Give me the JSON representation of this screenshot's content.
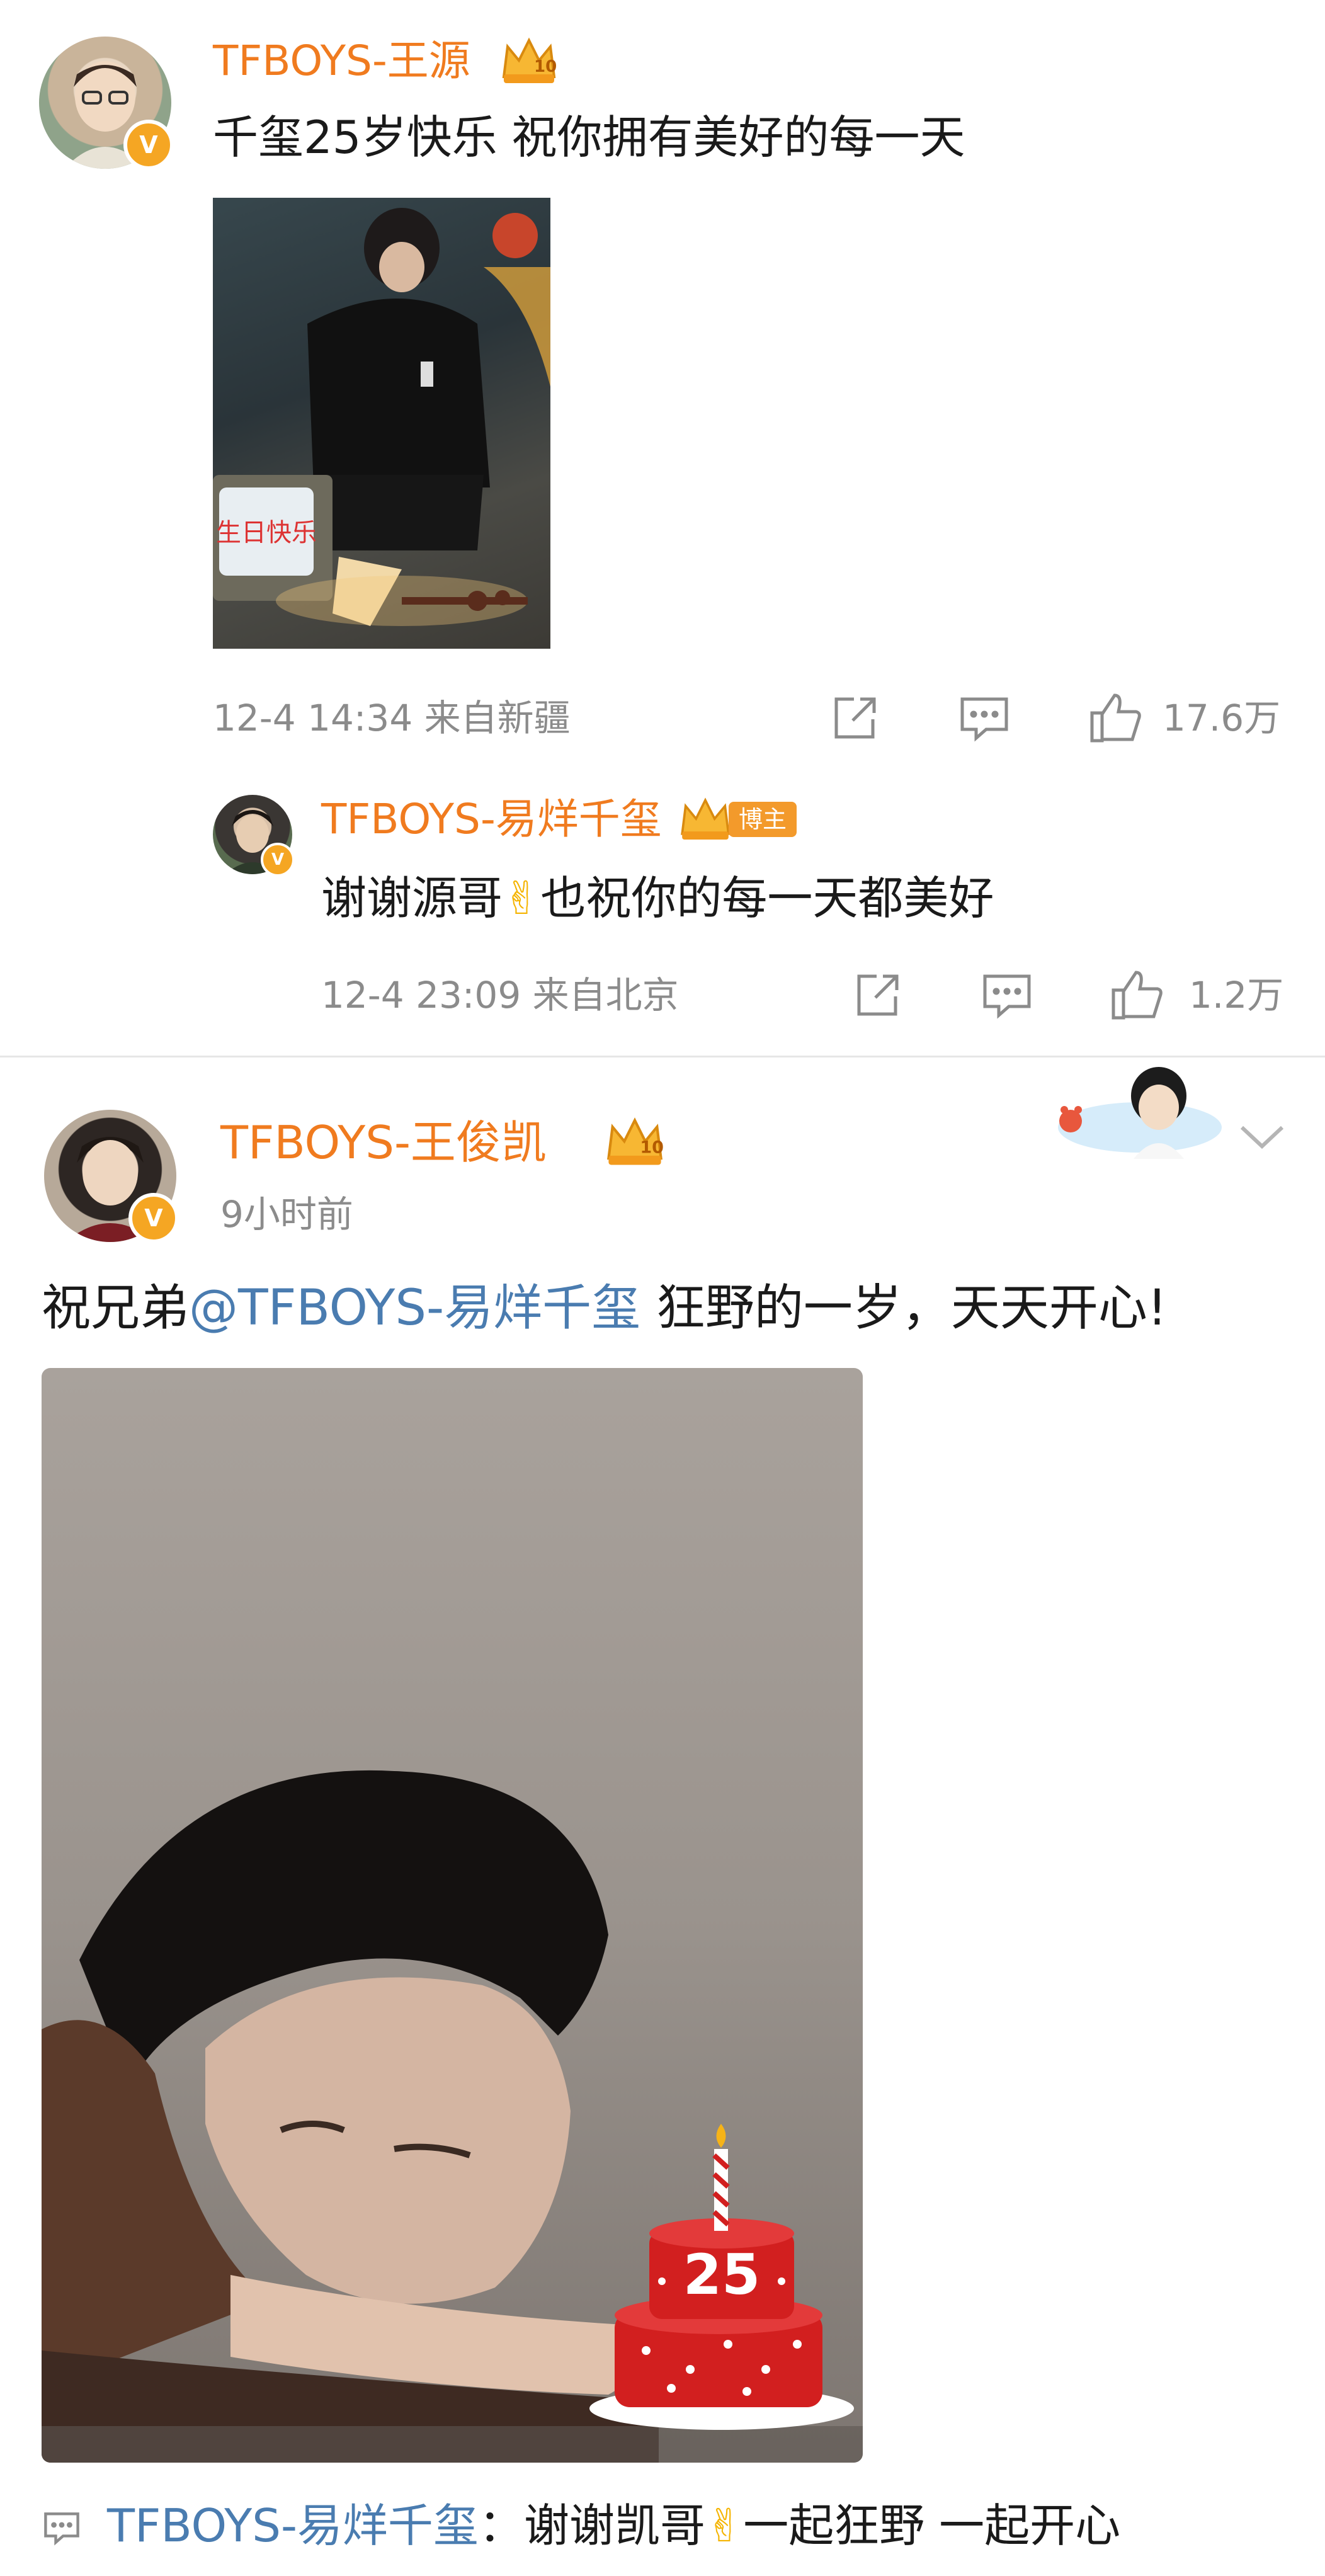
{
  "post1": {
    "author": "TFBOYS-王源",
    "crown_level": "10",
    "text": "千玺25岁快乐 祝你拥有美好的每一天",
    "image_tv_text": "生日快乐",
    "meta": "12-4 14:34  来自新疆",
    "like_count": "17.6万",
    "reply": {
      "author": "TFBOYS-易烊千玺",
      "tag": "博主",
      "text_before_emoji": "谢谢源哥",
      "emoji": "✌",
      "text_after_emoji": "也祝你的每一天都美好",
      "meta": "12-4 23:09  来自北京",
      "like_count": "1.2万"
    }
  },
  "post2": {
    "author": "TFBOYS-王俊凯",
    "crown_level": "10",
    "time": "9小时前",
    "text_prefix": "祝兄弟",
    "mention": "@TFBOYS-易烊千玺",
    "text_suffix": " 狂野的一岁，天天开心!",
    "cake_number": "25",
    "comment": {
      "author": "TFBOYS-易烊千玺",
      "colon_text": "：谢谢凯哥",
      "emoji": "✌",
      "text_after_emoji": "一起狂野 一起开心"
    }
  },
  "colors": {
    "name_orange": "#f07b1f",
    "mention_blue": "#4a7cb0",
    "meta_gray": "#8b8b8b",
    "divider": "#e6e6e6"
  },
  "icons": [
    "share-icon",
    "comment-icon",
    "like-icon",
    "chevron-down-icon",
    "crown-icon",
    "verified-icon",
    "candle-icon"
  ]
}
